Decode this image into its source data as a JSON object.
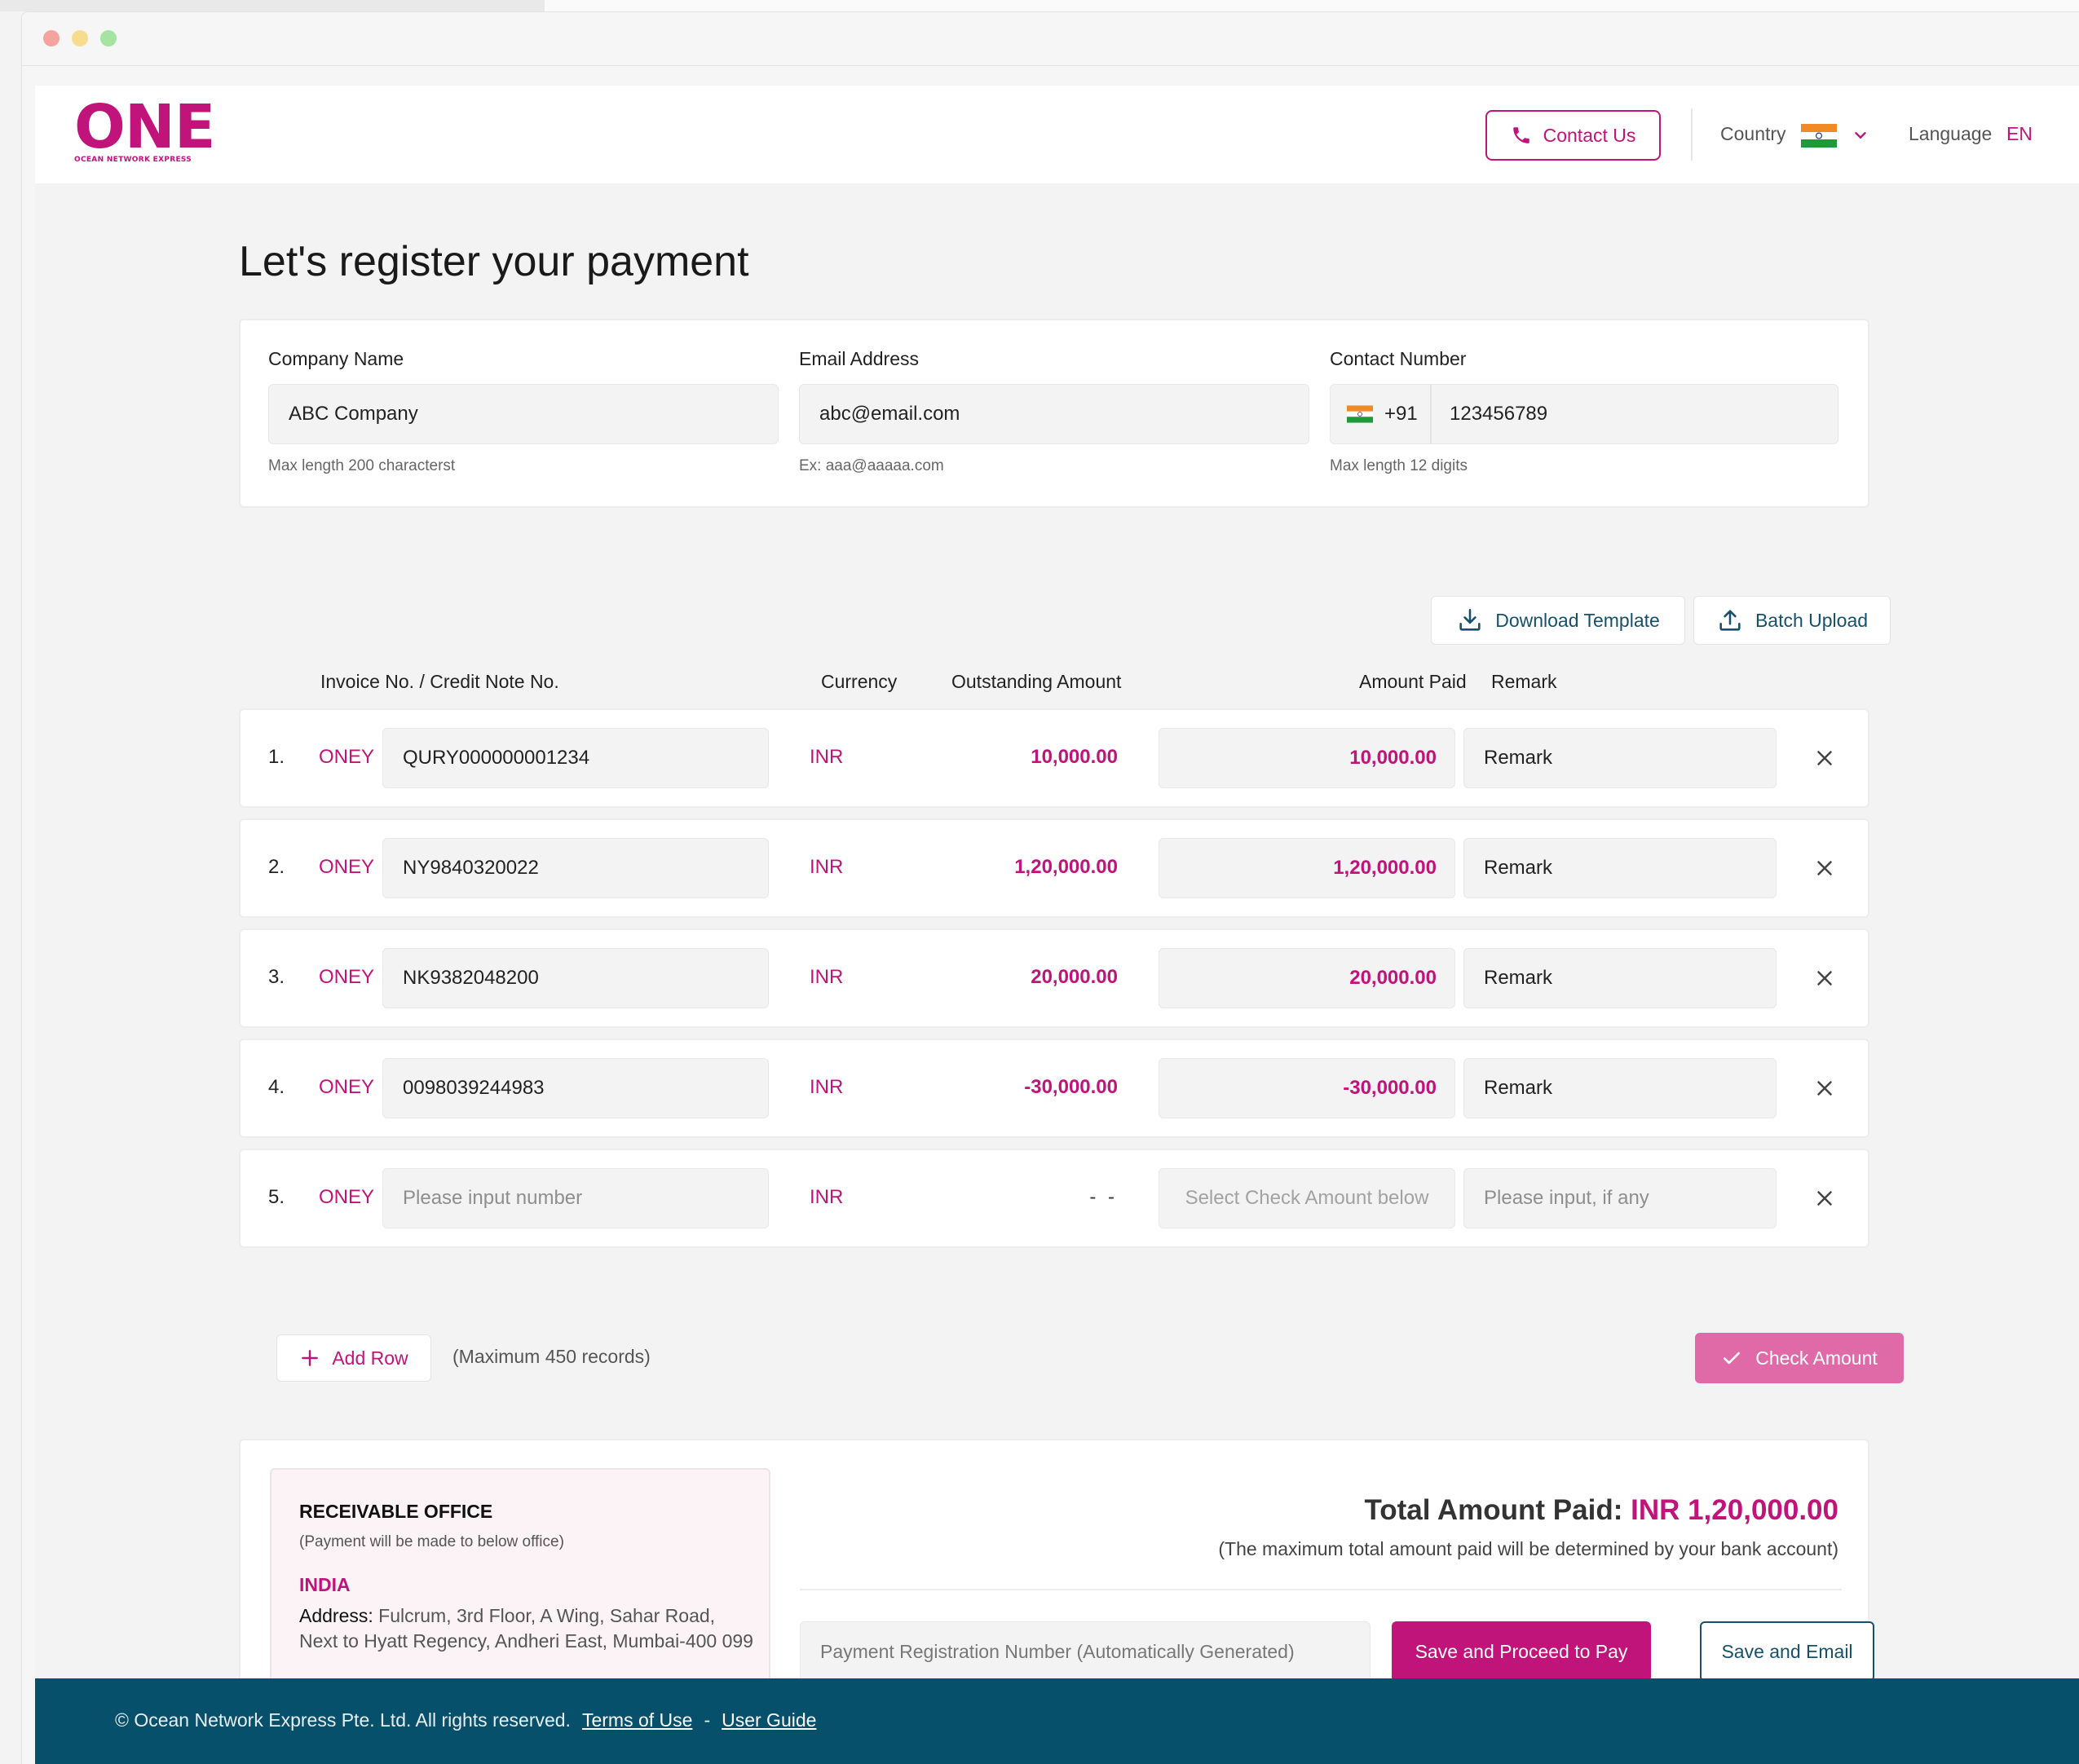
{
  "brand": {
    "logo_text": "ONE",
    "logo_subtext": "OCEAN NETWORK EXPRESS",
    "color": "#c0147a"
  },
  "header": {
    "contact_label": "Contact Us",
    "country_label": "Country",
    "country_flag": "india-flag-icon",
    "language_label": "Language",
    "language_value": "EN"
  },
  "page": {
    "title": "Let's register your payment"
  },
  "form": {
    "company": {
      "label": "Company Name",
      "value": "ABC Company",
      "hint": "Max length 200 characterst"
    },
    "email": {
      "label": "Email Address",
      "value": "abc@email.com",
      "hint": "Ex: aaa@aaaaa.com"
    },
    "phone": {
      "label": "Contact Number",
      "code": "+91",
      "value": "123456789",
      "hint": "Max length 12 digits"
    }
  },
  "actions": {
    "download_template": "Download Template",
    "batch_upload": "Batch Upload"
  },
  "table": {
    "columns": {
      "invoice": "Invoice No. / Credit Note No.",
      "currency": "Currency",
      "outstanding": "Outstanding Amount",
      "paid": "Amount Paid",
      "remark": "Remark"
    },
    "rows": [
      {
        "index": "1.",
        "prefix": "ONEY",
        "invoice": "QURY000000001234",
        "currency": "INR",
        "outstanding": "10,000.00",
        "paid": "10,000.00",
        "remark": "Remark"
      },
      {
        "index": "2.",
        "prefix": "ONEY",
        "invoice": "NY9840320022",
        "currency": "INR",
        "outstanding": "1,20,000.00",
        "paid": "1,20,000.00",
        "remark": "Remark"
      },
      {
        "index": "3.",
        "prefix": "ONEY",
        "invoice": "NK9382048200",
        "currency": "INR",
        "outstanding": "20,000.00",
        "paid": "20,000.00",
        "remark": "Remark"
      },
      {
        "index": "4.",
        "prefix": "ONEY",
        "invoice": "0098039244983",
        "currency": "INR",
        "outstanding": "-30,000.00",
        "paid": "-30,000.00",
        "remark": "Remark"
      },
      {
        "index": "5.",
        "prefix": "ONEY",
        "invoice_placeholder": "Please input number",
        "currency": "INR",
        "outstanding": "- -",
        "paid_placeholder": "Select Check Amount below",
        "remark_placeholder": "Please input, if any"
      }
    ],
    "add_row_label": "Add Row",
    "max_note": "(Maximum 450 records)",
    "check_amount_label": "Check Amount"
  },
  "summary": {
    "office_title": "RECEIVABLE OFFICE",
    "office_note": "(Payment will be made to below office)",
    "office_country": "INDIA",
    "address_label": "Address:",
    "address_value": "Fulcrum, 3rd Floor, A Wing, Sahar Road, Next to Hyatt Regency, Andheri East, Mumbai-400 099",
    "total_label": "Total Amount Paid:",
    "total_value": "INR 1,20,000.00",
    "total_note": "(The maximum total amount paid will be determined by your bank account)",
    "prn_placeholder": "Payment Registration Number (Automatically Generated)",
    "proceed_label": "Save and Proceed to Pay",
    "email_label": "Save and Email"
  },
  "footer": {
    "copyright": "© Ocean Network Express Pte. Ltd. All rights reserved.",
    "terms": "Terms of Use",
    "separator": "-",
    "guide": "User Guide"
  },
  "colors": {
    "accent": "#c0147a",
    "accent_light": "#e06aa8",
    "navy": "#07506c",
    "link": "#16506b"
  }
}
